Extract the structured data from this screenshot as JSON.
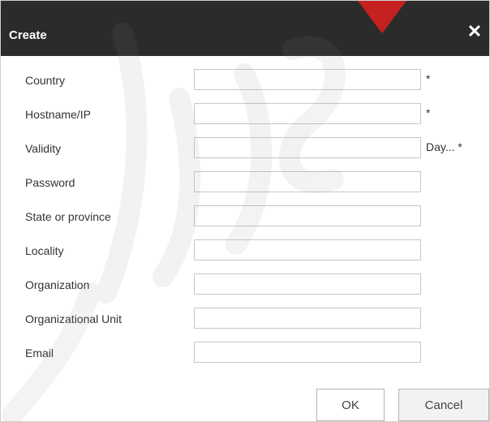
{
  "dialog": {
    "title": "Create",
    "close_icon": "close-icon"
  },
  "fields": [
    {
      "label": "Country",
      "value": "",
      "suffix": "*"
    },
    {
      "label": "Hostname/IP",
      "value": "",
      "suffix": "*"
    },
    {
      "label": "Validity",
      "value": "",
      "suffix": "Day... *"
    },
    {
      "label": "Password",
      "value": "",
      "suffix": ""
    },
    {
      "label": "State or province",
      "value": "",
      "suffix": ""
    },
    {
      "label": "Locality",
      "value": "",
      "suffix": ""
    },
    {
      "label": "Organization",
      "value": "",
      "suffix": ""
    },
    {
      "label": "Organizational Unit",
      "value": "",
      "suffix": ""
    },
    {
      "label": "Email",
      "value": "",
      "suffix": ""
    }
  ],
  "buttons": {
    "ok_label": "OK",
    "cancel_label": "Cancel"
  },
  "colors": {
    "titlebar": "#2b2b2b",
    "watermark": "#e02020"
  }
}
